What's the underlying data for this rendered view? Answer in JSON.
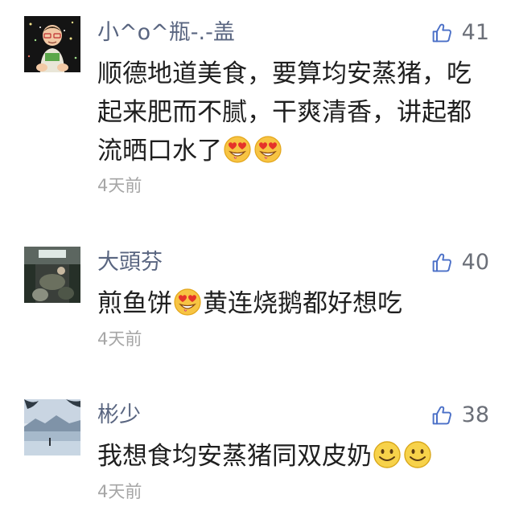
{
  "comments": [
    {
      "author": "小^o^瓶-.-盖",
      "likes": "41",
      "lines": [
        "顺德地道美食，要算均安蒸猪，吃",
        "起来肥而不腻，干爽清香，讲起都",
        "流晒口水了"
      ],
      "time": "4天前",
      "avatar": "toddler-photo-avatar"
    },
    {
      "author": "大頭芬",
      "likes": "40",
      "text_before": "煎鱼饼",
      "text_after": "黄连烧鹅都好想吃",
      "time": "4天前",
      "avatar": "restaurant-photo-avatar"
    },
    {
      "author": "彬少",
      "likes": "38",
      "text": "我想食均安蒸猪同双皮奶",
      "time": "4天前",
      "avatar": "lake-photo-avatar"
    }
  ],
  "colors": {
    "author": "#596580",
    "body": "#1f1f1f",
    "time": "#a6a6a6",
    "like_icon": "#4a6fc7"
  },
  "icons": {
    "like": "thumbs-up-icon",
    "emoji_love": "heart-eyes-emoji",
    "emoji_smile": "smile-emoji"
  }
}
